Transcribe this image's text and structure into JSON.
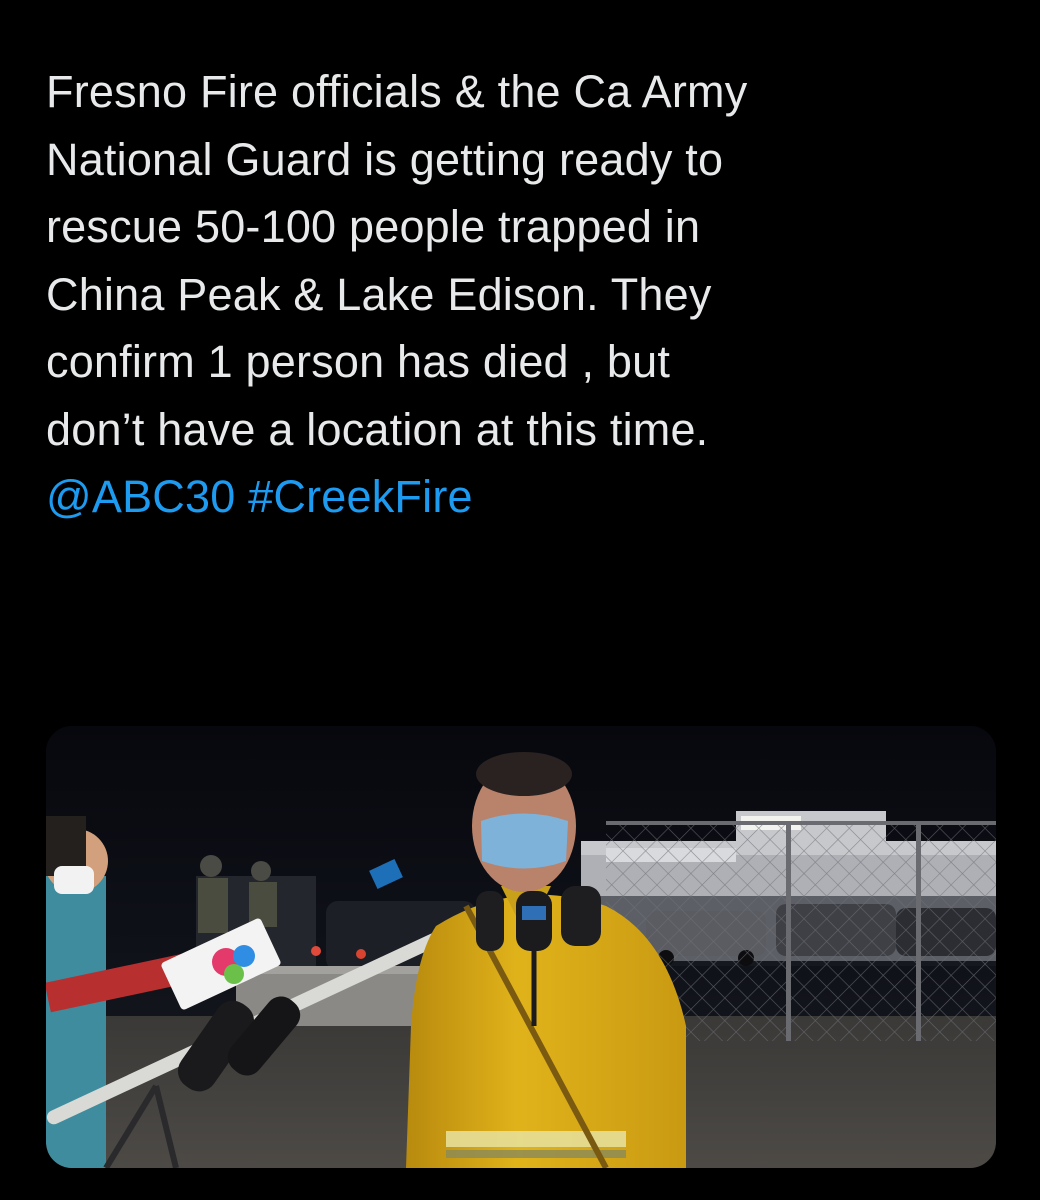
{
  "tweet": {
    "lines": [
      "Fresno Fire officials & the Ca Army",
      "National Guard is getting ready to",
      "rescue 50-100 people trapped in",
      "China Peak & Lake Edison. They",
      "confirm 1 person has died , but",
      "don’t have a location at this time."
    ],
    "mention": "@ABC30",
    "hashtag": "#CreekFire"
  },
  "media": {
    "kind": "video-still",
    "colors": {
      "background": "#000000",
      "text": "#e7e9ea",
      "link": "#1d9bf0",
      "jacket": "#e0b21a",
      "mask": "#7fb2d9"
    }
  }
}
